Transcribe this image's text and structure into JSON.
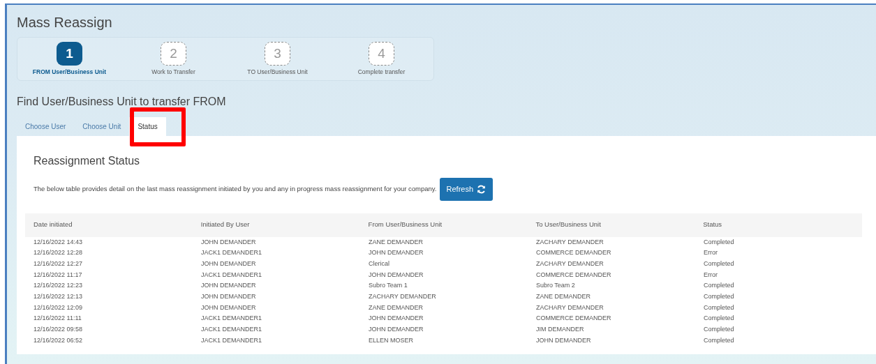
{
  "page_title": "Mass Reassign",
  "steps": [
    {
      "number": "1",
      "label": "FROM User/Business Unit",
      "selected": true
    },
    {
      "number": "2",
      "label": "Work to Transfer",
      "selected": false
    },
    {
      "number": "3",
      "label": "TO User/Business Unit",
      "selected": false
    },
    {
      "number": "4",
      "label": "Complete transfer",
      "selected": false
    }
  ],
  "section_heading": "Find User/Business Unit to transfer FROM",
  "tabs": [
    {
      "label": "Choose User",
      "selected": false,
      "highlighted": false
    },
    {
      "label": "Choose Unit",
      "selected": false,
      "highlighted": false
    },
    {
      "label": "Status",
      "selected": true,
      "highlighted": true
    }
  ],
  "panel": {
    "heading": "Reassignment Status",
    "description": "The below table provides detail on the last mass reassignment initiated by you and any in progress mass reassignment for your company.",
    "refresh_button": "Refresh"
  },
  "table": {
    "columns": [
      "Date initiated",
      "Initiated By User",
      "From User/Business Unit",
      "To User/Business Unit",
      "Status"
    ],
    "rows": [
      [
        "12/16/2022 14:43",
        "JOHN DEMANDER",
        "ZANE DEMANDER",
        "ZACHARY DEMANDER",
        "Completed"
      ],
      [
        "12/16/2022 12:28",
        "JACK1 DEMANDER1",
        "JOHN DEMANDER",
        "COMMERCE DEMANDER",
        "Error"
      ],
      [
        "12/16/2022 12:27",
        "JOHN DEMANDER",
        "Clerical",
        "ZACHARY DEMANDER",
        "Completed"
      ],
      [
        "12/16/2022 11:17",
        "JACK1 DEMANDER1",
        "JOHN DEMANDER",
        "COMMERCE DEMANDER",
        "Error"
      ],
      [
        "12/16/2022 12:23",
        "JOHN DEMANDER",
        "Subro Team 1",
        "Subro Team 2",
        "Completed"
      ],
      [
        "12/16/2022 12:13",
        "JOHN DEMANDER",
        "ZACHARY DEMANDER",
        "ZANE DEMANDER",
        "Completed"
      ],
      [
        "12/16/2022 12:09",
        "JOHN DEMANDER",
        "ZANE DEMANDER",
        "ZACHARY DEMANDER",
        "Completed"
      ],
      [
        "12/16/2022 11:11",
        "JACK1 DEMANDER1",
        "JOHN DEMANDER",
        "COMMERCE DEMANDER",
        "Completed"
      ],
      [
        "12/16/2022 09:58",
        "JACK1 DEMANDER1",
        "JOHN DEMANDER",
        "JIM DEMANDER",
        "Completed"
      ],
      [
        "12/16/2022 06:52",
        "JACK1 DEMANDER1",
        "ELLEN MOSER",
        "JOHN DEMANDER",
        "Completed"
      ]
    ]
  }
}
